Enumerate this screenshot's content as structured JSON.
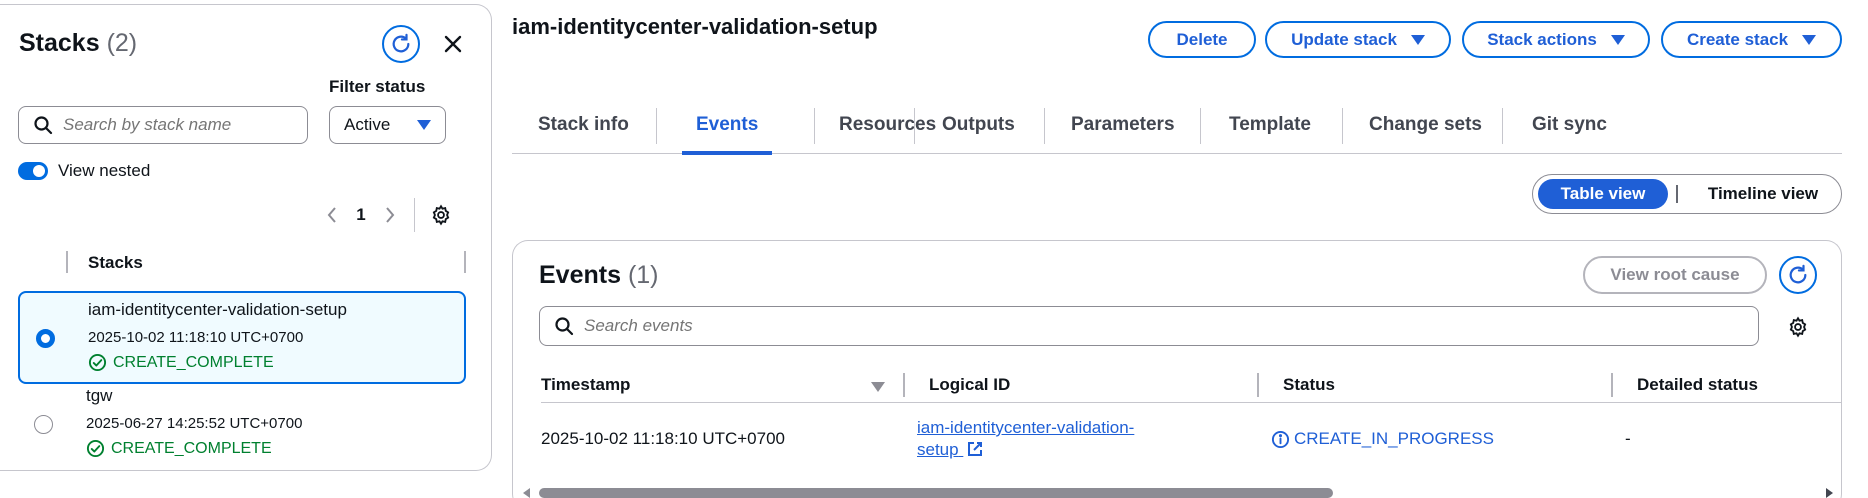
{
  "colors": {
    "accent": "#1f5fd6",
    "success": "#00802f",
    "border": "#c6c6cd",
    "selected_bg": "#f0fbff"
  },
  "left_panel": {
    "title": "Stacks",
    "count": "(2)",
    "refresh_icon": "refresh-icon",
    "close_icon": "close-icon",
    "filter_label": "Filter status",
    "search_placeholder": "Search by stack name",
    "filter_value": "Active",
    "view_nested_label": "View nested",
    "view_nested_on": true,
    "page": "1",
    "column_header": "Stacks",
    "stacks": [
      {
        "name": "iam-identitycenter-validation-setup",
        "timestamp": "2025-10-02 11:18:10 UTC+0700",
        "status": "CREATE_COMPLETE",
        "selected": true
      },
      {
        "name": "tgw",
        "timestamp": "2025-06-27 14:25:52 UTC+0700",
        "status": "CREATE_COMPLETE",
        "selected": false
      }
    ]
  },
  "main": {
    "title": "iam-identitycenter-validation-setup",
    "actions": {
      "delete": "Delete",
      "update": "Update stack",
      "stack_actions": "Stack actions",
      "create": "Create stack"
    },
    "tabs": [
      "Stack info",
      "Events",
      "Resources",
      "Outputs",
      "Parameters",
      "Template",
      "Change sets",
      "Git sync"
    ],
    "active_tab": "Events",
    "view_toggle": {
      "table": "Table view",
      "timeline": "Timeline view",
      "active": "Table view"
    },
    "events": {
      "title": "Events",
      "count": "(1)",
      "root_cause_label": "View root cause",
      "search_placeholder": "Search events",
      "columns": [
        "Timestamp",
        "Logical ID",
        "Status",
        "Detailed status"
      ],
      "rows": [
        {
          "timestamp": "2025-10-02 11:18:10 UTC+0700",
          "logical_id_line1": "iam-identitycenter-validation-",
          "logical_id_line2": "setup",
          "status": "CREATE_IN_PROGRESS",
          "detailed_status": "-"
        }
      ]
    }
  }
}
